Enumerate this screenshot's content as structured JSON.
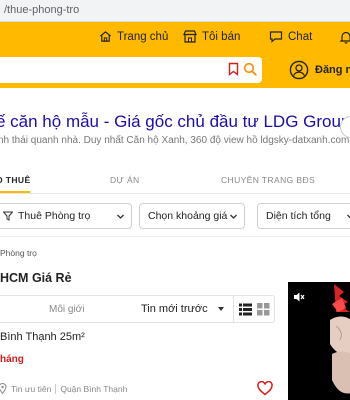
{
  "browser": {
    "url": "/thue-phong-tro"
  },
  "nav": {
    "home": "Trang chủ",
    "seller": "Tôi bán",
    "chat": "Chat"
  },
  "search": {
    "placeholder": ""
  },
  "account": {
    "login_label": "Đăng nh"
  },
  "ad": {
    "title": "ế căn hộ mẫu - Giá gốc chủ đầu tư LDG Group",
    "subtitle": "nh thái quanh nhà. Duy nhất Căn hộ Xanh, 360 độ view hồ ldgsky-datxanh.com"
  },
  "tabs": [
    {
      "label": "O THUÊ",
      "active": true
    },
    {
      "label": "DỰ ÁN",
      "active": false
    },
    {
      "label": "CHUYÊN TRANG BĐS",
      "active": false
    }
  ],
  "filters": {
    "category": "Thuê Phòng trọ",
    "price": "Chọn khoảng giá",
    "area": "Diện tích tổng"
  },
  "breadcrumb": "Phòng trọ",
  "page_title": "HCM Giá Rẻ",
  "sort": {
    "source": "Môi giới",
    "selected": "Tin mới trước"
  },
  "listing": {
    "title": "Bình Thạnh 25m²",
    "price": "háng",
    "priority": "Tin ưu tiên",
    "district": "Quận Bình Thạnh"
  },
  "colors": {
    "brand_yellow": "#ffba00",
    "price_red": "#d61c1c",
    "ad_blue": "#1a0dab"
  }
}
